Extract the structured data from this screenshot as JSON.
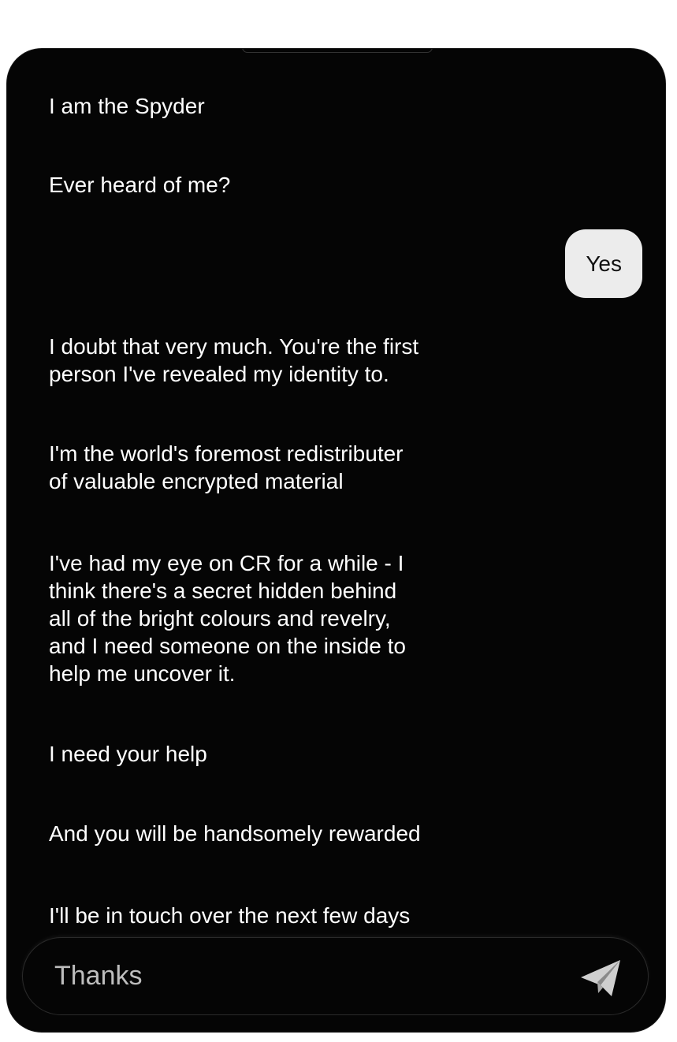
{
  "messages": [
    {
      "text": "I am the Spyder",
      "from": "bot"
    },
    {
      "text": "Ever heard of me?",
      "from": "bot"
    },
    {
      "text": "Yes",
      "from": "user"
    },
    {
      "text": "I doubt that very much. You're the first\nperson I've revealed my identity to.",
      "from": "bot"
    },
    {
      "text": "I'm the world's foremost redistributer\nof valuable encrypted material",
      "from": "bot"
    },
    {
      "text": "I've had my eye on CR for a while - I\nthink there's a secret hidden behind\nall of the bright colours and revelry,\nand I need someone on the inside to\nhelp me uncover it.",
      "from": "bot"
    },
    {
      "text": "I need your help",
      "from": "bot"
    },
    {
      "text": "And you will be handsomely rewarded",
      "from": "bot"
    },
    {
      "text": "I'll be in touch over the next few days",
      "from": "bot"
    }
  ],
  "composer": {
    "value": "Thanks",
    "send_icon": "paper-plane-icon"
  },
  "colors": {
    "background": "#050505",
    "bot_text": "#ffffff",
    "user_bubble": "#ececec",
    "user_text": "#111111",
    "input_text": "#bdbdbd",
    "send_icon": "#cfcfcf"
  }
}
